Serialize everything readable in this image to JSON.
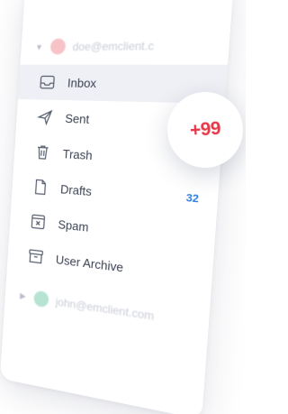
{
  "accounts": [
    {
      "email": "doe@emclient.c",
      "avatar_color": "#f7c3c6"
    },
    {
      "email": "john@emclient.com",
      "avatar_color": "#b7e3d3"
    }
  ],
  "folders": [
    {
      "label": "Inbox",
      "icon": "inbox-icon",
      "selected": true,
      "count": ""
    },
    {
      "label": "Sent",
      "icon": "send-icon",
      "selected": false,
      "count": ""
    },
    {
      "label": "Trash",
      "icon": "trash-icon",
      "selected": false,
      "count": ""
    },
    {
      "label": "Drafts",
      "icon": "draft-icon",
      "selected": false,
      "count": "32"
    },
    {
      "label": "Spam",
      "icon": "spam-icon",
      "selected": false,
      "count": ""
    },
    {
      "label": "User Archive",
      "icon": "archive-icon",
      "selected": false,
      "count": ""
    }
  ],
  "unread_badge": "+99",
  "colors": {
    "badge_text": "#e8394a",
    "count_text": "#2f7de1",
    "selected_bg": "#eef0f5"
  }
}
